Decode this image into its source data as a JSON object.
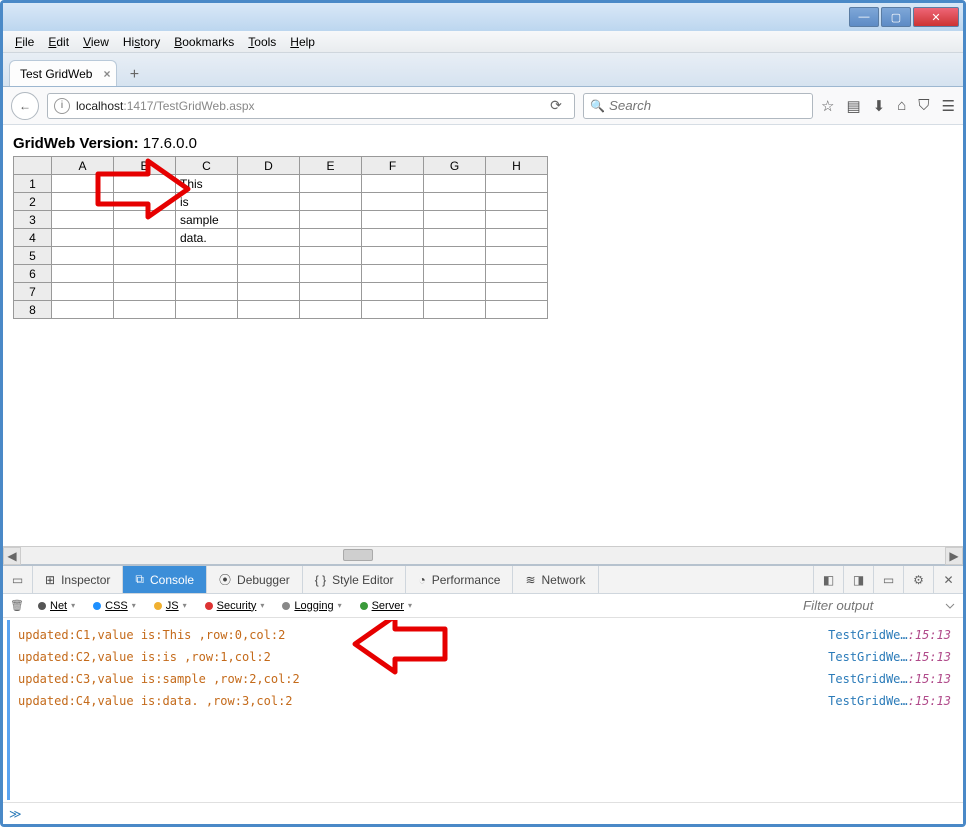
{
  "menubar": [
    "File",
    "Edit",
    "View",
    "History",
    "Bookmarks",
    "Tools",
    "Help"
  ],
  "tab": {
    "title": "Test GridWeb"
  },
  "url": {
    "host": "localhost",
    "port": ":1417",
    "path": "/TestGridWeb.aspx"
  },
  "search": {
    "placeholder": "Search"
  },
  "page": {
    "version_label": "GridWeb Version:",
    "version_value": "17.6.0.0",
    "columns": [
      "A",
      "B",
      "C",
      "D",
      "E",
      "F",
      "G",
      "H"
    ],
    "rows": [
      1,
      2,
      3,
      4,
      5,
      6,
      7,
      8
    ],
    "cells": {
      "C1": "This",
      "C2": "is",
      "C3": "sample",
      "C4": "data."
    }
  },
  "devtools": {
    "tabs": {
      "inspector": "Inspector",
      "console": "Console",
      "debugger": "Debugger",
      "style": "Style Editor",
      "perf": "Performance",
      "network": "Network"
    },
    "filters": {
      "net": "Net",
      "css": "CSS",
      "js": "JS",
      "security": "Security",
      "logging": "Logging",
      "server": "Server"
    },
    "filter_placeholder": "Filter output",
    "source": "TestGridWe…",
    "time": ":15:13",
    "logs": [
      "updated:C1,value is:This ,row:0,col:2",
      "updated:C2,value is:is ,row:1,col:2",
      "updated:C3,value is:sample ,row:2,col:2",
      "updated:C4,value is:data. ,row:3,col:2"
    ]
  }
}
